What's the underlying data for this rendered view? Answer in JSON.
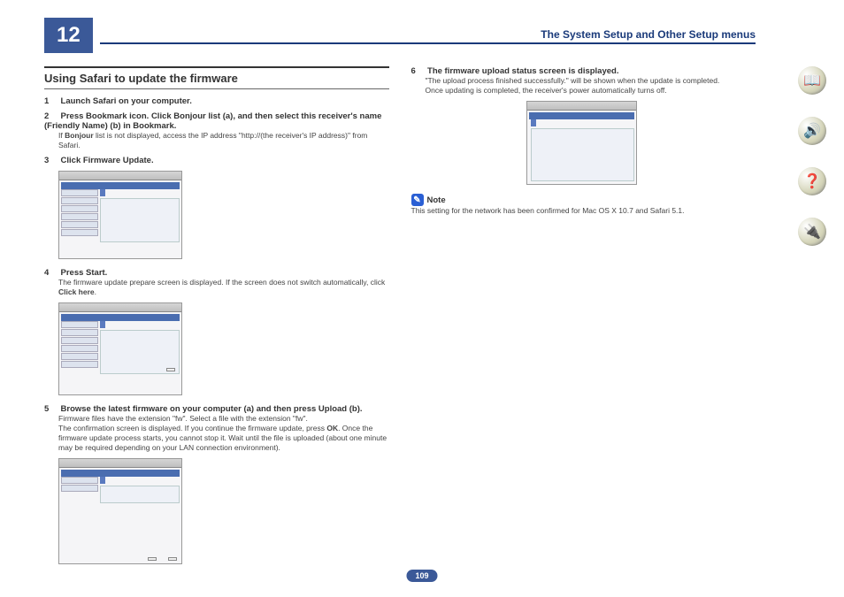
{
  "chapter_number": "12",
  "header_title": "The System Setup and Other Setup menus",
  "section_title": "Using Safari to update the firmware",
  "left": {
    "step1": {
      "num": "1",
      "bold": "Launch Safari on your computer."
    },
    "step2": {
      "num": "2",
      "bold": "Press Bookmark icon. Click Bonjour list (a), and then select this receiver's name (Friendly Name) (b) in Bookmark."
    },
    "step2_body_prefix": "If ",
    "step2_body_bold": "Bonjour",
    "step2_body_suffix": " list is not displayed, access the IP address \"http://(the receiver's IP address)\" from Safari.",
    "step3": {
      "num": "3",
      "bold": "Click Firmware Update."
    },
    "step4": {
      "num": "4",
      "bold": "Press Start."
    },
    "step4_body_prefix": "The firmware update prepare screen is displayed. If the screen does not switch automatically, click ",
    "step4_body_bold": "Click here",
    "step4_body_suffix": ".",
    "step5": {
      "num": "5",
      "bold": "Browse the latest firmware on your computer (a) and then press Upload (b)."
    },
    "step5_body_line1": "Firmware files have the extension \"fw\". Select a file with the extension \"fw\".",
    "step5_body_line2_prefix": "The confirmation screen is displayed. If you continue the firmware update, press ",
    "step5_body_line2_bold": "OK",
    "step5_body_line2_suffix": ". Once the firmware update process starts, you cannot stop it. Wait until the file is uploaded (about one minute may be required depending on your LAN connection environment)."
  },
  "right": {
    "step6": {
      "num": "6",
      "bold": "The firmware upload status screen is displayed."
    },
    "step6_body_quote": "\"The upload process finished successfully.\"",
    "step6_body_suffix": " will be shown when the update is completed.",
    "step6_body_line2": "Once updating is completed, the receiver's power automatically turns off.",
    "note_label": "Note",
    "note_body": "This setting for the network has been confirmed for Mac OS X 10.7 and Safari 5.1."
  },
  "page_number": "109",
  "side_icons": {
    "a": "book-icon",
    "b": "speakers-icon",
    "c": "help-icon",
    "d": "network-icon"
  },
  "glyphs": {
    "book": "📖",
    "speakers": "🔊",
    "help": "❓",
    "network": "🔌"
  }
}
